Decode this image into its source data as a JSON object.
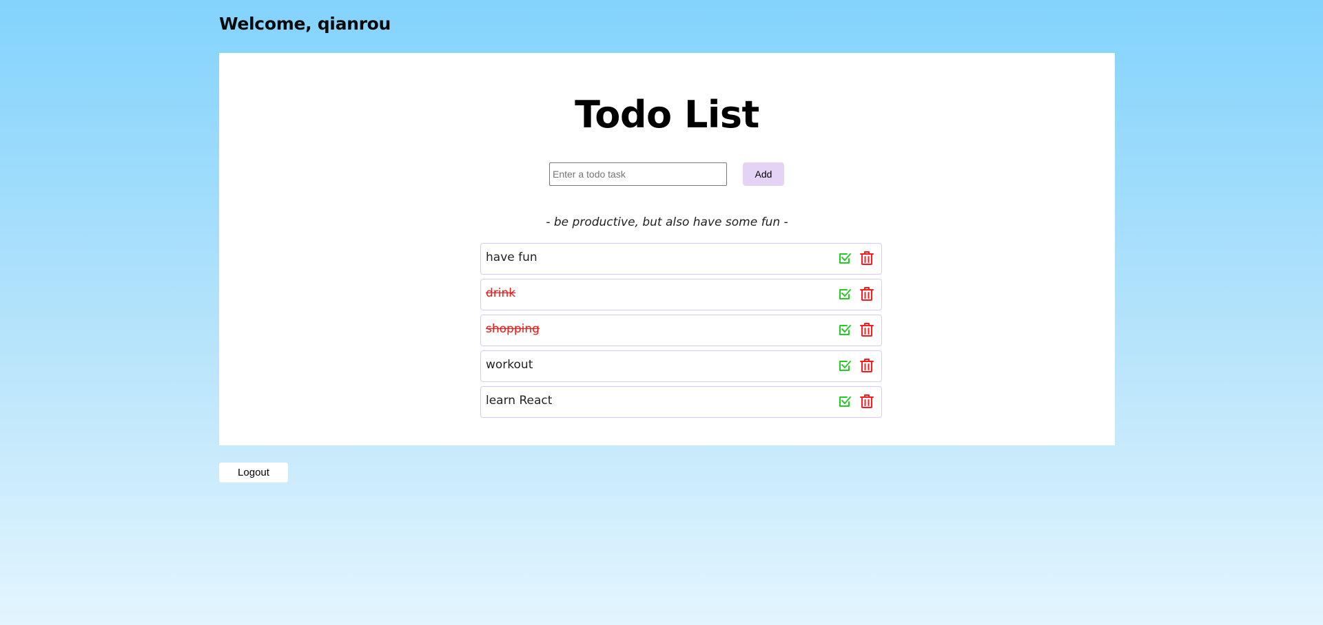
{
  "header": {
    "welcome": "Welcome, qianrou"
  },
  "main": {
    "title": "Todo List",
    "input": {
      "placeholder": "Enter a todo task",
      "value": ""
    },
    "add_label": "Add",
    "tagline": "- be productive, but also have some fun -",
    "todos": [
      {
        "text": "have fun",
        "completed": false
      },
      {
        "text": "drink",
        "completed": true
      },
      {
        "text": "shopping",
        "completed": true
      },
      {
        "text": "workout",
        "completed": false
      },
      {
        "text": "learn React",
        "completed": false
      }
    ],
    "icons": {
      "complete": "check-square-icon",
      "delete": "trash-icon"
    }
  },
  "footer": {
    "logout_label": "Logout"
  },
  "colors": {
    "background_top": "#83d3fd",
    "background_bottom": "#e3f5fe",
    "add_button": "#e5d3f5",
    "item_border": "#dcc8f2",
    "completed_text": "#ff1010",
    "check_icon": "#22cc22",
    "trash_icon": "#ff1a1a"
  }
}
